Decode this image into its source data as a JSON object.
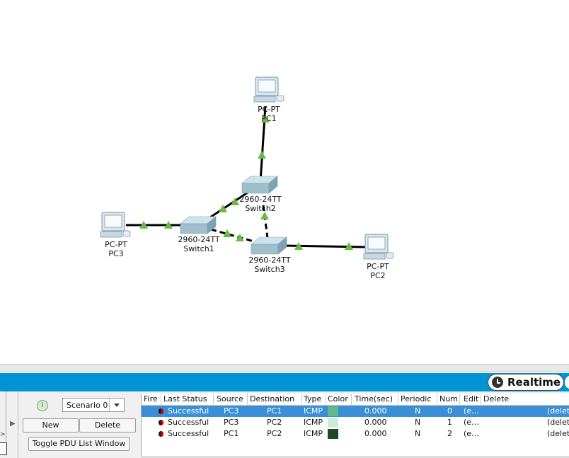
{
  "topology": {
    "devices": [
      {
        "id": "pc1",
        "model": "PC-PT",
        "name": "PC1",
        "kind": "pc"
      },
      {
        "id": "pc2",
        "model": "PC-PT",
        "name": "PC2",
        "kind": "pc"
      },
      {
        "id": "pc3",
        "model": "PC-PT",
        "name": "PC3",
        "kind": "pc"
      },
      {
        "id": "sw1",
        "model": "2960-24TT",
        "name": "Switch1",
        "kind": "switch"
      },
      {
        "id": "sw2",
        "model": "2960-24TT",
        "name": "Switch2",
        "kind": "switch"
      },
      {
        "id": "sw3",
        "model": "2960-24TT",
        "name": "Switch3",
        "kind": "switch"
      }
    ],
    "link_color": "#000000",
    "link_status_color": "#66bb44"
  },
  "mode_bar": {
    "mode_label": "Realtime",
    "mode_icon": "clock-icon",
    "bar_color": "#0094d5"
  },
  "scenario": {
    "info_icon": "info-icon",
    "info_label": "i",
    "selected": "Scenario 0",
    "new_label": "New",
    "delete_label": "Delete",
    "toggle_label": "Toggle PDU List Window"
  },
  "pdu_table": {
    "headers": [
      "Fire",
      "Last Status",
      "Source",
      "Destination",
      "Type",
      "Color",
      "Time(sec)",
      "Periodic",
      "Num",
      "Edit",
      "Delete"
    ],
    "rows": [
      {
        "status": "Successful",
        "source": "PC3",
        "destination": "PC1",
        "type": "ICMP",
        "color": "#66b88a",
        "time": "0.000",
        "periodic": "N",
        "num": "0",
        "edit": "(e…",
        "delete": "(delet",
        "selected": true
      },
      {
        "status": "Successful",
        "source": "PC3",
        "destination": "PC2",
        "type": "ICMP",
        "color": "#cdebd6",
        "time": "0.000",
        "periodic": "N",
        "num": "1",
        "edit": "(e…",
        "delete": "(delet",
        "selected": false
      },
      {
        "status": "Successful",
        "source": "PC1",
        "destination": "PC2",
        "type": "ICMP",
        "color": "#1f4a27",
        "time": "0.000",
        "periodic": "N",
        "num": "2",
        "edit": "(e…",
        "delete": "(delet",
        "selected": false
      }
    ]
  }
}
